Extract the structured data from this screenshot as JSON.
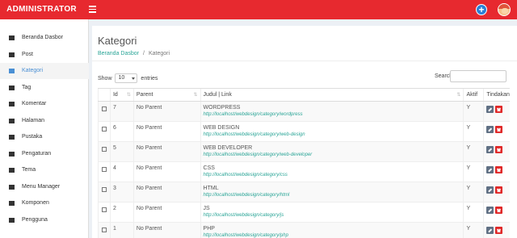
{
  "topbar": {
    "brand": "ADMINISTRATOR"
  },
  "sidebar": {
    "items": [
      {
        "label": "Beranda Dasbor",
        "icon": "dashboard-icon"
      },
      {
        "label": "Post",
        "icon": "pin-icon"
      },
      {
        "label": "Kategori",
        "icon": "list-icon",
        "active": true
      },
      {
        "label": "Tag",
        "icon": "tags-icon"
      },
      {
        "label": "Komentar",
        "icon": "comments-icon"
      },
      {
        "label": "Halaman",
        "icon": "file-icon"
      },
      {
        "label": "Pustaka",
        "icon": "image-icon"
      },
      {
        "label": "Pengaturan",
        "icon": "gear-icon"
      },
      {
        "label": "Tema",
        "icon": "desktop-icon"
      },
      {
        "label": "Menu Manager",
        "icon": "sitemap-icon"
      },
      {
        "label": "Komponen",
        "icon": "cubes-icon"
      },
      {
        "label": "Pengguna",
        "icon": "users-icon"
      }
    ]
  },
  "main": {
    "title": "Kategori",
    "breadcrumb": {
      "home": "Beranda Dasbor",
      "sep": "/",
      "current": "Kategori"
    },
    "show_label": "Show",
    "entries_value": "10",
    "entries_label": "entries",
    "search_label": "Search:"
  },
  "table": {
    "headers": {
      "id": "Id",
      "parent": "Parent",
      "judul": "Judul | Link",
      "aktif": "Aktif",
      "tindakan": "Tindakan"
    },
    "rows": [
      {
        "id": "7",
        "parent": "No Parent",
        "title": "WORDPRESS",
        "link": "http://localhost/webdesign/category/wordpress",
        "aktif": "Y"
      },
      {
        "id": "6",
        "parent": "No Parent",
        "title": "WEB DESIGN",
        "link": "http://localhost/webdesign/category/web-design",
        "aktif": "Y"
      },
      {
        "id": "5",
        "parent": "No Parent",
        "title": "WEB DEVELOPER",
        "link": "http://localhost/webdesign/category/web-developer",
        "aktif": "Y"
      },
      {
        "id": "4",
        "parent": "No Parent",
        "title": "CSS",
        "link": "http://localhost/webdesign/category/css",
        "aktif": "Y"
      },
      {
        "id": "3",
        "parent": "No Parent",
        "title": "HTML",
        "link": "http://localhost/webdesign/category/html",
        "aktif": "Y"
      },
      {
        "id": "2",
        "parent": "No Parent",
        "title": "JS",
        "link": "http://localhost/webdesign/category/js",
        "aktif": "Y"
      },
      {
        "id": "1",
        "parent": "No Parent",
        "title": "PHP",
        "link": "http://localhost/webdesign/category/php",
        "aktif": "Y"
      }
    ]
  },
  "colors": {
    "brand_red": "#e7292f",
    "link_teal": "#2aa597",
    "active_blue": "#4a8fd4",
    "delete_red": "#e02929",
    "edit_gray": "#607084"
  }
}
